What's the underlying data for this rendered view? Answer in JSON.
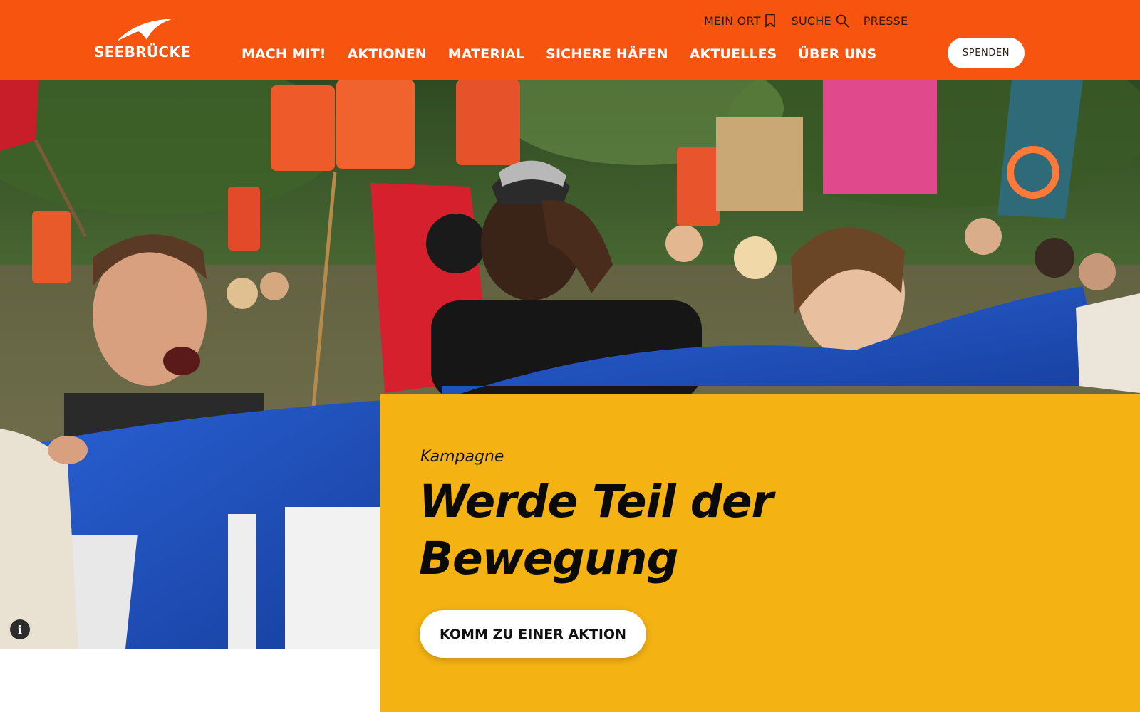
{
  "header": {
    "logo_text": "SEEBRÜCKE",
    "utility_nav": [
      {
        "label": "MEIN ORT",
        "icon": "bookmark-icon"
      },
      {
        "label": "SUCHE",
        "icon": "search-icon"
      },
      {
        "label": "PRESSE"
      }
    ],
    "main_nav": [
      "MACH MIT!",
      "AKTIONEN",
      "MATERIAL",
      "SICHERE HÄFEN",
      "AKTUELLES",
      "ÜBER UNS"
    ],
    "donate_label": "SPENDEN"
  },
  "hero": {
    "info_icon_glyph": "i",
    "kicker": "Kampagne",
    "headline_line1": "Werde Teil der",
    "headline_line2": "Bewegung",
    "cta_label": "KOMM ZU EINER AKTION"
  },
  "colors": {
    "brand_orange": "#f7540f",
    "campaign_yellow": "#f4b312",
    "banner_blue": "#1f55c9",
    "text_dark": "#0a0a0a"
  }
}
